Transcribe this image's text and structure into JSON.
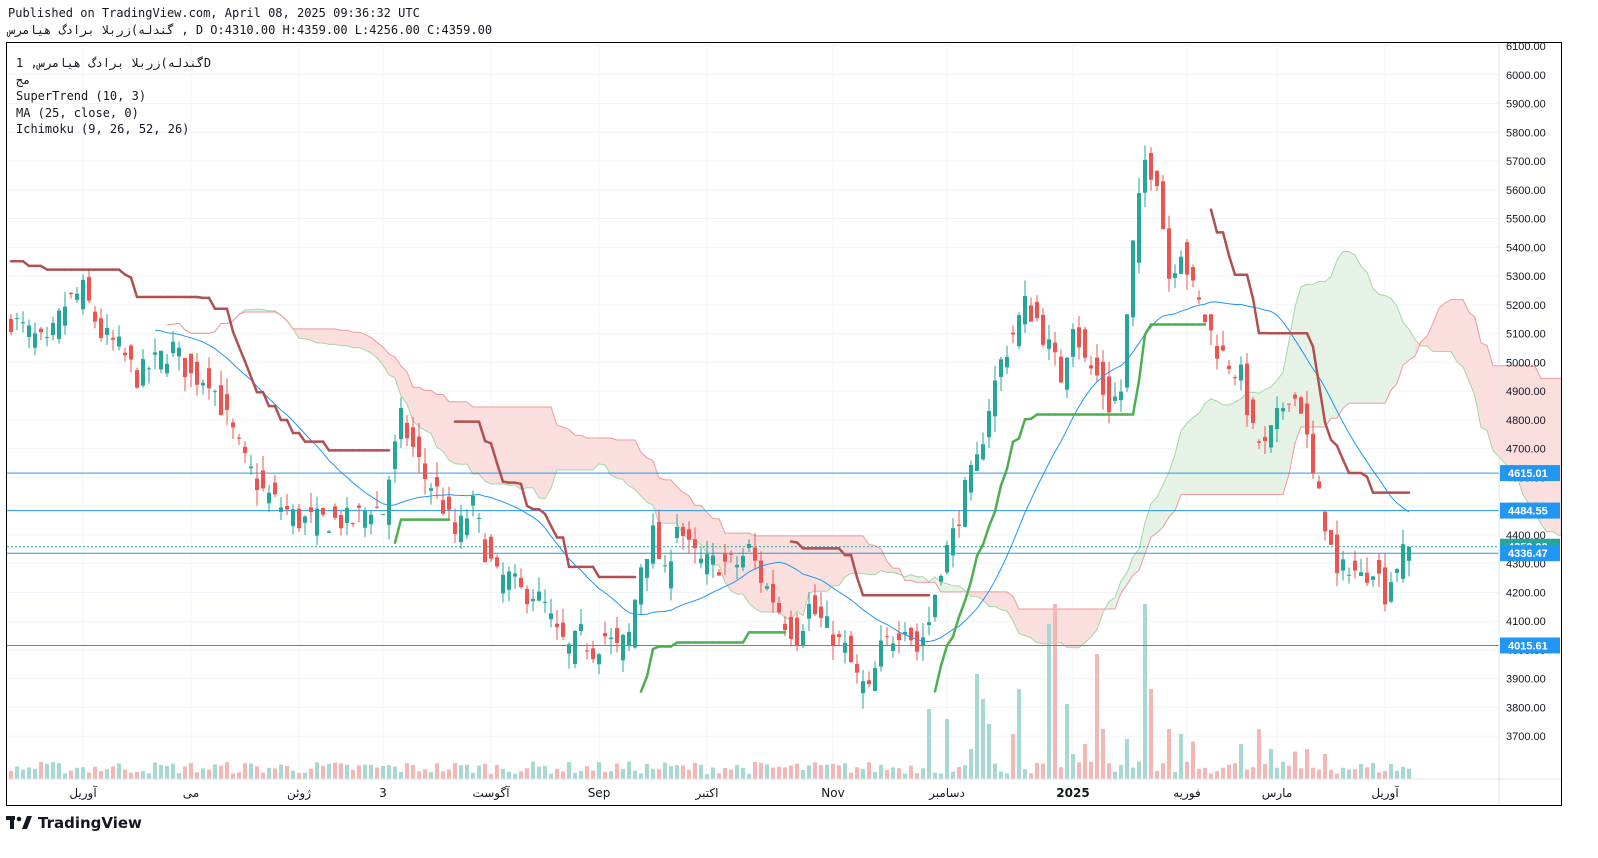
{
  "header": {
    "published": "Published on TradingView.com, April 08, 2025 09:36:32 UTC",
    "ohlc": "گندله)زربلا برادگ هیامرس , D O:4310.00 H:4359.00 L:4256.00 C:4359.00"
  },
  "legend": {
    "symbol": "گندله)زربلا برادگ هیامرس, 1D",
    "sub": "مج",
    "supertrend": "SuperTrend (10, 3)",
    "ma": "MA (25, close, 0)",
    "ichimoku": "Ichimoku (9, 26, 52, 26)"
  },
  "brand": {
    "name": "TradingView",
    "icon": "tradingview-logo-icon"
  },
  "colors": {
    "up": "#26a69a",
    "down": "#ef5350",
    "ma": "#2196f3",
    "supertrend_up": "#4caf50",
    "supertrend_down": "#b05050",
    "cloud_bull": "#e6f2e6",
    "cloud_bear": "#fbdede",
    "level_line": "#2196f3",
    "price_label": "#26a69a"
  },
  "chart_data": {
    "type": "candlestick",
    "ylim": [
      3600,
      6100
    ],
    "yticks": [
      3700,
      3800,
      3900,
      4000,
      4100,
      4200,
      4300,
      4400,
      4500,
      4600,
      4700,
      4800,
      4900,
      5000,
      5100,
      5200,
      5300,
      5400,
      5500,
      5600,
      5700,
      5800,
      5900,
      6000,
      6100
    ],
    "ytick_labels": [
      "3700.00",
      "3800.00",
      "3900.00",
      "4000.00",
      "4100.00",
      "4200.00",
      "4300.00",
      "4400.00",
      "4500.00",
      "4600.00",
      "4700.00",
      "4800.00",
      "4900.00",
      "5000.00",
      "5100.00",
      "5200.00",
      "5300.00",
      "5400.00",
      "5500.00",
      "5600.00",
      "5700.00",
      "5800.00",
      "5900.00",
      "6000.00",
      "6100.00"
    ],
    "x_labels": [
      {
        "text": "آوریل",
        "i": 12
      },
      {
        "text": "می",
        "i": 30
      },
      {
        "text": "ژوئن",
        "i": 48
      },
      {
        "text": "3",
        "i": 62
      },
      {
        "text": "آگوست",
        "i": 80
      },
      {
        "text": "Sep",
        "i": 98
      },
      {
        "text": "اکتبر",
        "i": 116
      },
      {
        "text": "Nov",
        "i": 137
      },
      {
        "text": "دسامبر",
        "i": 156
      },
      {
        "text": "2025",
        "i": 177
      },
      {
        "text": "فوریه",
        "i": 196
      },
      {
        "text": "مارس",
        "i": 211
      },
      {
        "text": "آوریل",
        "i": 229
      }
    ],
    "horizontal_levels": [
      4615.01,
      4484.55,
      4336.47,
      4015.61
    ],
    "last_price": 4359.0,
    "price_labels": [
      {
        "text": "4615.01",
        "value": 4615.01,
        "kind": "level"
      },
      {
        "text": "4484.55",
        "value": 4484.55,
        "kind": "level"
      },
      {
        "text": "4359.00",
        "value": 4359.0,
        "kind": "last"
      },
      {
        "text": "4336.47",
        "value": 4336.47,
        "kind": "level"
      },
      {
        "text": "4015.61",
        "value": 4015.61,
        "kind": "level"
      }
    ],
    "close_anchors": [
      [
        0,
        5150
      ],
      [
        3,
        5100
      ],
      [
        6,
        5050
      ],
      [
        9,
        5200
      ],
      [
        12,
        5250
      ],
      [
        15,
        5100
      ],
      [
        18,
        5050
      ],
      [
        21,
        4950
      ],
      [
        24,
        5000
      ],
      [
        27,
        5050
      ],
      [
        30,
        4950
      ],
      [
        33,
        4950
      ],
      [
        36,
        4800
      ],
      [
        39,
        4650
      ],
      [
        42,
        4550
      ],
      [
        45,
        4500
      ],
      [
        48,
        4450
      ],
      [
        51,
        4450
      ],
      [
        54,
        4450
      ],
      [
        57,
        4450
      ],
      [
        60,
        4500
      ],
      [
        62,
        4480
      ],
      [
        63,
        4600
      ],
      [
        65,
        4800
      ],
      [
        67,
        4700
      ],
      [
        69,
        4600
      ],
      [
        71,
        4550
      ],
      [
        74,
        4400
      ],
      [
        77,
        4500
      ],
      [
        79,
        4350
      ],
      [
        81,
        4250
      ],
      [
        83,
        4250
      ],
      [
        85,
        4200
      ],
      [
        87,
        4200
      ],
      [
        89,
        4150
      ],
      [
        91,
        4050
      ],
      [
        93,
        4000
      ],
      [
        95,
        4050
      ],
      [
        97,
        4000
      ],
      [
        99,
        4050
      ],
      [
        101,
        4000
      ],
      [
        103,
        4050
      ],
      [
        105,
        4300
      ],
      [
        107,
        4400
      ],
      [
        109,
        4250
      ],
      [
        111,
        4450
      ],
      [
        113,
        4350
      ],
      [
        115,
        4300
      ],
      [
        118,
        4300
      ],
      [
        121,
        4300
      ],
      [
        123,
        4350
      ],
      [
        125,
        4250
      ],
      [
        127,
        4180
      ],
      [
        129,
        4100
      ],
      [
        131,
        4050
      ],
      [
        133,
        4150
      ],
      [
        135,
        4100
      ],
      [
        137,
        4050
      ],
      [
        139,
        4000
      ],
      [
        141,
        3900
      ],
      [
        143,
        3850
      ],
      [
        145,
        4000
      ],
      [
        147,
        4050
      ],
      [
        149,
        4100
      ],
      [
        151,
        4000
      ],
      [
        153,
        4100
      ],
      [
        155,
        4300
      ],
      [
        157,
        4400
      ],
      [
        159,
        4550
      ],
      [
        161,
        4650
      ],
      [
        163,
        4850
      ],
      [
        165,
        5000
      ],
      [
        167,
        5100
      ],
      [
        169,
        5200
      ],
      [
        171,
        5150
      ],
      [
        173,
        5050
      ],
      [
        175,
        4950
      ],
      [
        177,
        5150
      ],
      [
        179,
        5000
      ],
      [
        181,
        4950
      ],
      [
        183,
        4850
      ],
      [
        185,
        4900
      ],
      [
        187,
        5400
      ],
      [
        189,
        5700
      ],
      [
        191,
        5650
      ],
      [
        193,
        5300
      ],
      [
        195,
        5400
      ],
      [
        197,
        5250
      ],
      [
        199,
        5150
      ],
      [
        201,
        5050
      ],
      [
        203,
        5000
      ],
      [
        205,
        4950
      ],
      [
        207,
        4750
      ],
      [
        209,
        4700
      ],
      [
        211,
        4800
      ],
      [
        213,
        4900
      ],
      [
        215,
        4850
      ],
      [
        217,
        4600
      ],
      [
        219,
        4450
      ],
      [
        221,
        4250
      ],
      [
        223,
        4300
      ],
      [
        225,
        4250
      ],
      [
        227,
        4300
      ],
      [
        229,
        4200
      ],
      [
        231,
        4300
      ],
      [
        233,
        4359
      ]
    ],
    "volume_spikes": [
      [
        153,
        0.28
      ],
      [
        156,
        0.24
      ],
      [
        160,
        0.12
      ],
      [
        161,
        0.42
      ],
      [
        162,
        0.32
      ],
      [
        163,
        0.22
      ],
      [
        167,
        0.18
      ],
      [
        168,
        0.36
      ],
      [
        173,
        0.62
      ],
      [
        174,
        0.7
      ],
      [
        176,
        0.3
      ],
      [
        177,
        0.1
      ],
      [
        179,
        0.14
      ],
      [
        181,
        0.5
      ],
      [
        182,
        0.2
      ],
      [
        186,
        0.16
      ],
      [
        189,
        0.7
      ],
      [
        190,
        0.36
      ],
      [
        193,
        0.2
      ],
      [
        195,
        0.18
      ],
      [
        197,
        0.15
      ],
      [
        205,
        0.14
      ],
      [
        208,
        0.2
      ],
      [
        210,
        0.12
      ],
      [
        214,
        0.11
      ],
      [
        216,
        0.12
      ],
      [
        219,
        0.1
      ]
    ]
  }
}
